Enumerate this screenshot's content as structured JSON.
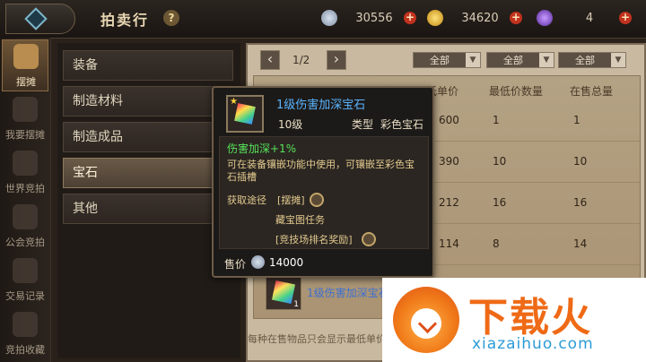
{
  "header": {
    "title": "拍卖行",
    "help": "?",
    "resources": [
      {
        "icon": "silver-coin-icon",
        "value": "30556"
      },
      {
        "icon": "gold-coin-icon",
        "value": "34620"
      },
      {
        "icon": "purple-gem-icon",
        "value": "4"
      }
    ],
    "plus": "+"
  },
  "sidebar": {
    "items": [
      {
        "label": "摆摊",
        "active": true
      },
      {
        "label": "我要摆摊"
      },
      {
        "label": "世界竞拍"
      },
      {
        "label": "公会竞拍"
      },
      {
        "label": "交易记录"
      },
      {
        "label": "竞拍收藏"
      }
    ]
  },
  "categories": [
    "装备",
    "制造材料",
    "制造成品",
    "宝石",
    "其他"
  ],
  "active_category": "宝石",
  "list": {
    "page": "1/2",
    "prev": "‹",
    "next": "›",
    "filters": [
      "全部",
      "全部",
      "全部"
    ],
    "filter_caret": "▼",
    "columns": [
      "最低单价",
      "最低价数量",
      "在售总量"
    ],
    "rows": [
      {
        "price": "600",
        "min_qty": "1",
        "total": "1"
      },
      {
        "price": "390",
        "min_qty": "10",
        "total": "10"
      },
      {
        "price": "212",
        "min_qty": "16",
        "total": "16"
      },
      {
        "price": "114",
        "min_qty": "8",
        "total": "14"
      }
    ],
    "last_item_name": "1级伤害加深宝石",
    "last_item_count": "1",
    "footer_note": "每种在售物品只会显示最低单价"
  },
  "tooltip": {
    "name": "1级伤害加深宝石",
    "level": "10级",
    "type_label": "类型",
    "type_value": "彩色宝石",
    "stat": "伤害加深+1%",
    "description": "可在装备镶嵌功能中使用，可镶嵌至彩色宝石插槽",
    "source_label": "获取途径",
    "sources": [
      "[摆摊]",
      "藏宝图任务",
      "[竞技场排名奖励]"
    ],
    "price_label": "售价",
    "price": "14000"
  },
  "watermark": {
    "cn": "下载火",
    "en": "xiazaihuo.com"
  }
}
